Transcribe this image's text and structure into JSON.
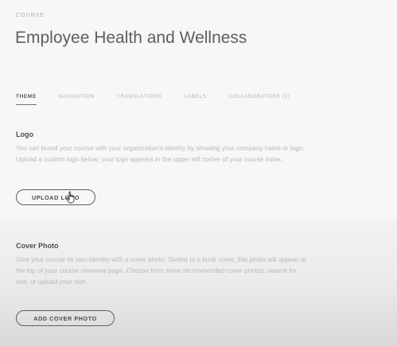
{
  "header": {
    "eyebrow": "COURSE",
    "title": "Employee Health and Wellness"
  },
  "tabs": [
    {
      "label": "THEME",
      "active": true
    },
    {
      "label": "NAVIGATION",
      "active": false
    },
    {
      "label": "TRANSLATIONS",
      "active": false
    },
    {
      "label": "LABELS",
      "active": false
    },
    {
      "label": "COLLABORATORS (1)",
      "active": false
    }
  ],
  "logo_section": {
    "heading": "Logo",
    "description_1": "You can brand your course with your organization's identity by showing your company name or logo.",
    "description_2": "Upload a custom logo below; your logo appears in the upper left corner of your course index.",
    "button_label": "UPLOAD LOGO"
  },
  "cover_section": {
    "heading": "Cover Photo",
    "description_1": "Give your course its own identity with a cover photo. Similar to a book cover, this photo will appear at",
    "description_2": "the top of your course overview page. Choose from some recommended cover photos, search for",
    "description_3": "one, or upload your own.",
    "button_label": "ADD COVER PHOTO"
  },
  "icons": {
    "cursor": "hand-pointer-icon"
  }
}
